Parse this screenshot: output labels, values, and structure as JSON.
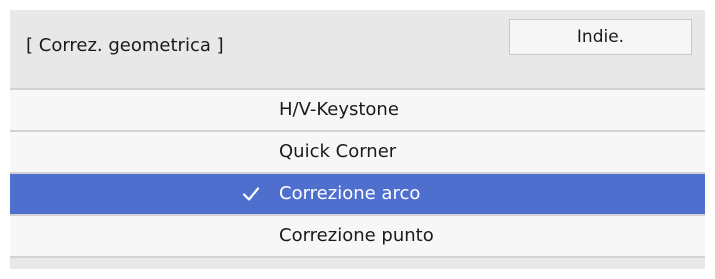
{
  "header": {
    "title": "[ Correz. geometrica ]",
    "back_label": "Indie."
  },
  "menu": {
    "items": [
      {
        "label": "H/V-Keystone",
        "selected": false
      },
      {
        "label": "Quick Corner",
        "selected": false
      },
      {
        "label": "Correzione arco",
        "selected": true
      },
      {
        "label": "Correzione punto",
        "selected": false
      }
    ],
    "check_icon": "checkmark-icon"
  },
  "colors": {
    "background": "#e8e8e8",
    "row_background": "#f7f7f7",
    "selected_background": "#4f6fcf",
    "selected_text": "#ffffff",
    "text": "#1a1a1a",
    "button_background": "#f6f6f6"
  }
}
